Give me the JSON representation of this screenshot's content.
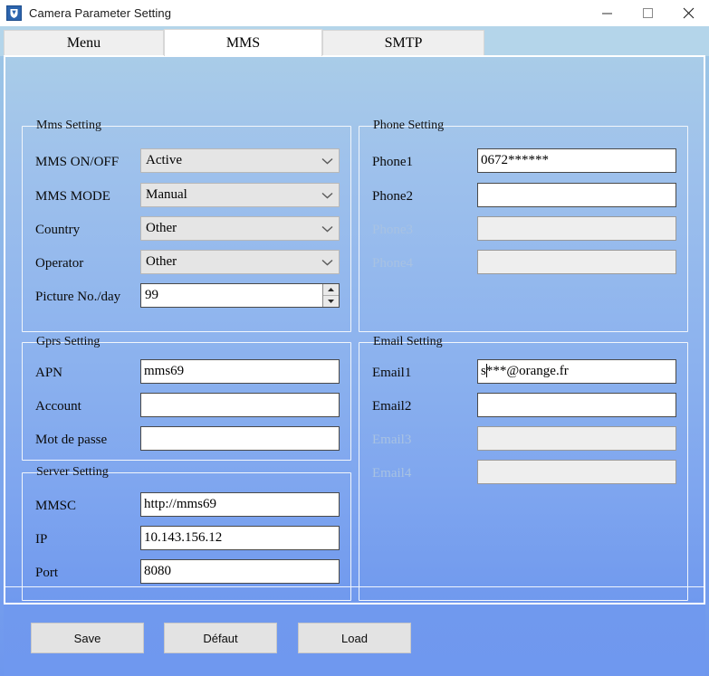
{
  "window": {
    "title": "Camera Parameter Setting",
    "icon": "camera-app-icon",
    "minimize_label": "–",
    "maximize_label": "□",
    "close_label": "✕"
  },
  "tabs": [
    {
      "label": "Menu",
      "active": false
    },
    {
      "label": "MMS",
      "active": true
    },
    {
      "label": "SMTP",
      "active": false
    }
  ],
  "groups": {
    "mms_setting": {
      "title": "Mms Setting",
      "fields": [
        {
          "label": "MMS ON/OFF",
          "type": "combo",
          "value": "Active",
          "disabled": false
        },
        {
          "label": "MMS MODE",
          "type": "combo",
          "value": "Manual",
          "disabled": false
        },
        {
          "label": "Country",
          "type": "combo",
          "value": "Other",
          "disabled": false
        },
        {
          "label": "Operator",
          "type": "combo",
          "value": "Other",
          "disabled": false
        },
        {
          "label": "Picture No./day",
          "type": "spinner",
          "value": "99",
          "disabled": false
        }
      ]
    },
    "gprs_setting": {
      "title": "Gprs Setting",
      "fields": [
        {
          "label": "APN",
          "type": "text",
          "value": "mms69",
          "disabled": false
        },
        {
          "label": "Account",
          "type": "text",
          "value": "",
          "disabled": false
        },
        {
          "label": "Mot de passe",
          "type": "text",
          "value": "",
          "disabled": false
        }
      ]
    },
    "server_setting": {
      "title": "Server Setting",
      "fields": [
        {
          "label": "MMSC",
          "type": "text",
          "value": "http://mms69",
          "disabled": false
        },
        {
          "label": "IP",
          "type": "text",
          "value": "10.143.156.12",
          "disabled": false
        },
        {
          "label": "Port",
          "type": "text",
          "value": "8080",
          "disabled": false
        }
      ]
    },
    "phone_setting": {
      "title": "Phone Setting",
      "fields": [
        {
          "label": "Phone1",
          "type": "text",
          "value": "0672******",
          "disabled": false
        },
        {
          "label": "Phone2",
          "type": "text",
          "value": "",
          "disabled": false
        },
        {
          "label": "Phone3",
          "type": "text",
          "value": "",
          "disabled": true
        },
        {
          "label": "Phone4",
          "type": "text",
          "value": "",
          "disabled": true
        }
      ]
    },
    "email_setting": {
      "title": "Email Setting",
      "fields": [
        {
          "label": "Email1",
          "type": "text",
          "value": "s***@orange.fr",
          "disabled": false,
          "caret_after": 1
        },
        {
          "label": "Email2",
          "type": "text",
          "value": "",
          "disabled": false
        },
        {
          "label": "Email3",
          "type": "text",
          "value": "",
          "disabled": true
        },
        {
          "label": "Email4",
          "type": "text",
          "value": "",
          "disabled": true
        }
      ]
    }
  },
  "buttons": [
    {
      "label": "Save",
      "name": "save-button"
    },
    {
      "label": "Défaut",
      "name": "default-button"
    },
    {
      "label": "Load",
      "name": "load-button"
    }
  ],
  "colors": {
    "page_gradient_top": "#a9cce8",
    "page_gradient_bottom": "#7099ee",
    "tabstrip": "#b4d5ea",
    "active_tab": "#ffffff",
    "inactive_tab": "#efefef",
    "combo_face": "#e5e5e5",
    "disabled_field": "#eeeeee",
    "disabled_label": "#a8c2e2",
    "button_face": "#e3e3e3"
  }
}
